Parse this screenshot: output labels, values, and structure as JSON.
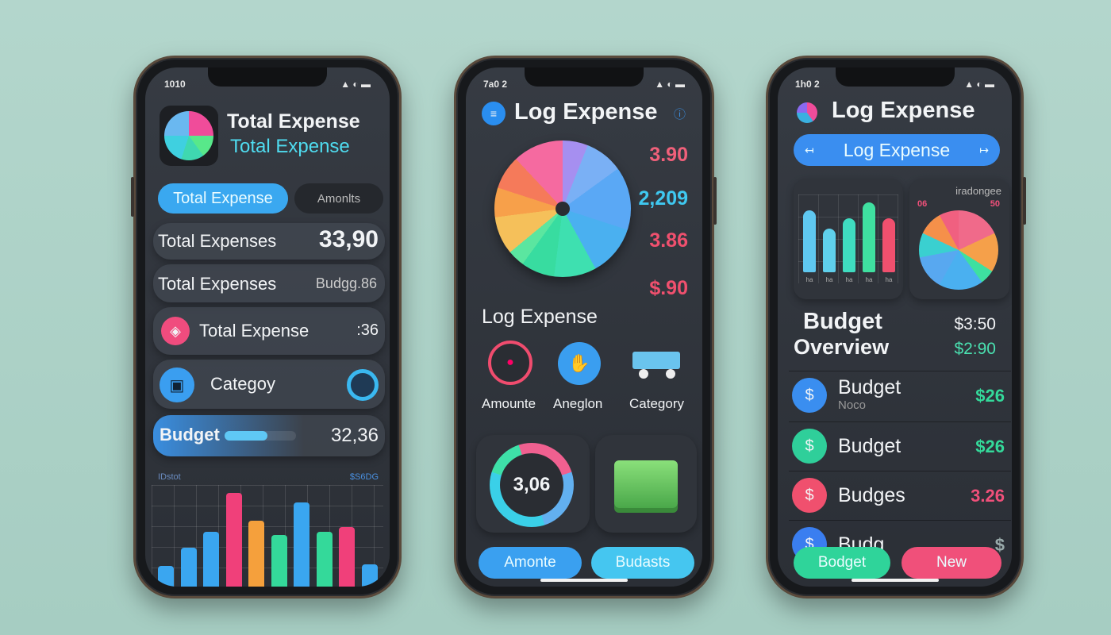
{
  "colors": {
    "background": "#a9cfc4",
    "screen": "#2f343b",
    "blue": "#3aa6f0",
    "pink": "#f0407a",
    "green": "#34d99a",
    "orange": "#f5a03c",
    "cyan": "#3fd0f0"
  },
  "phone1": {
    "status_time": "1010",
    "title": "Total Expense",
    "subtitle": "Total Expense",
    "pill_active": "Total Expense",
    "pill_inactive": "Amonlts",
    "rows": [
      {
        "label": "Total Expenses",
        "value": "33,90"
      },
      {
        "label": "Total Expenses",
        "value": "Budgg.86"
      },
      {
        "label": "Total Expense",
        "value": ":36",
        "icon": "tag-icon"
      },
      {
        "label": "Categoy",
        "icon": "wallet-icon",
        "trail_icon": "refresh-ring-icon"
      },
      {
        "label": "Budget",
        "value": "32,36",
        "progress": 0.6
      }
    ],
    "chart_left_label": "IDstot",
    "chart_right_label": "$S6DG",
    "bars": [
      {
        "value": 33,
        "color": "#3aa6f0"
      },
      {
        "value": 56,
        "color": "#3aa6f0"
      },
      {
        "value": 76,
        "color": "#3aa6f0"
      },
      {
        "value": 126,
        "color": "#f0407a"
      },
      {
        "value": 90,
        "color": "#f5a03c"
      },
      {
        "value": 72,
        "color": "#34d99a"
      },
      {
        "value": 114,
        "color": "#3aa6f0"
      },
      {
        "value": 76,
        "color": "#34d99a"
      },
      {
        "value": 82,
        "color": "#f0407a"
      },
      {
        "value": 35,
        "color": "#3aa6f0"
      }
    ]
  },
  "phone2": {
    "status_time": "7a0 2",
    "title": "Log Expense",
    "values": [
      {
        "value": "3.90",
        "color": "#f0607a"
      },
      {
        "value": "2,209",
        "color": "#3fc8f0"
      },
      {
        "value": "3.86",
        "color": "#f0506e"
      },
      {
        "value": "$.90",
        "color": "#f0506e"
      }
    ],
    "section_title": "Log Expense",
    "actions": [
      {
        "label": "Amounte",
        "icon": "record-icon"
      },
      {
        "label": "Aneglon",
        "icon": "hand-icon"
      },
      {
        "label": "Category",
        "icon": "cart-icon"
      }
    ],
    "ring_value": "3,06",
    "buttons": [
      "Amonte",
      "Budasts"
    ]
  },
  "phone3": {
    "status_time": "1h0 2",
    "title": "Log Expense",
    "pill": "Log Expense",
    "chart_bars": [
      {
        "value": 78,
        "color": "#5fc8f0",
        "label": "ha"
      },
      {
        "value": 55,
        "color": "#5fd0ec",
        "label": "ha"
      },
      {
        "value": 68,
        "color": "#3fdcc0",
        "label": "ha"
      },
      {
        "value": 88,
        "color": "#3fe0a0",
        "label": "ha"
      },
      {
        "value": 68,
        "color": "#f0506e",
        "label": "ha"
      }
    ],
    "pie_title": "iradongee",
    "pie_left": "06",
    "pie_right": "50",
    "overview_title": [
      "Budget",
      "Overview"
    ],
    "overview_values": [
      "$3:50",
      "$2:90"
    ],
    "list": [
      {
        "label": "Budget",
        "sub": "Noco",
        "value": "$26",
        "color": "#3a8ef0",
        "value_color": "#34d99a"
      },
      {
        "label": "Budget",
        "value": "$26",
        "color": "#2fcf9a",
        "value_color": "#34d99a"
      },
      {
        "label": "Budges",
        "value": "3.26",
        "color": "#f0506e",
        "value_color": "#f0507a"
      },
      {
        "label": "Budg",
        "value": "$",
        "color": "#3a7ef0",
        "value_color": "#9aa"
      }
    ],
    "buttons": [
      "Bodget",
      "New"
    ]
  }
}
